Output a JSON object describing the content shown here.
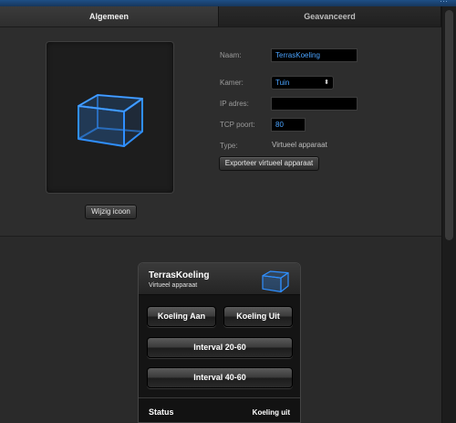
{
  "tabs": [
    {
      "label": "Algemeen",
      "active": true
    },
    {
      "label": "Geavanceerd",
      "active": false
    }
  ],
  "icon_preview": {
    "icon": "cube-icon",
    "color": "#2f8fff"
  },
  "buttons": {
    "change_icon": "Wijzig icoon",
    "export": "Exporteer virtueel apparaat"
  },
  "form": {
    "name_label": "Naam:",
    "name_value": "TerrasKoeling",
    "room_label": "Kamer:",
    "room_value": "Tuin",
    "ip_label": "IP adres:",
    "ip_value": "",
    "tcp_label": "TCP poort:",
    "tcp_value": "80",
    "type_label": "Type:",
    "type_value": "Virtueel apparaat"
  },
  "preview": {
    "title": "TerrasKoeling",
    "subtitle": "Virtueel apparaat",
    "icon": "cube-icon",
    "buttons": [
      "Koeling Aan",
      "Koeling Uit",
      "Interval 20-60",
      "Interval 40-60"
    ],
    "status_label": "Status",
    "status_value": "Koeling uit"
  },
  "colors": {
    "accent": "#2f8fff",
    "field_text": "#4aa3ff",
    "titlebar": "#1e4f86"
  }
}
